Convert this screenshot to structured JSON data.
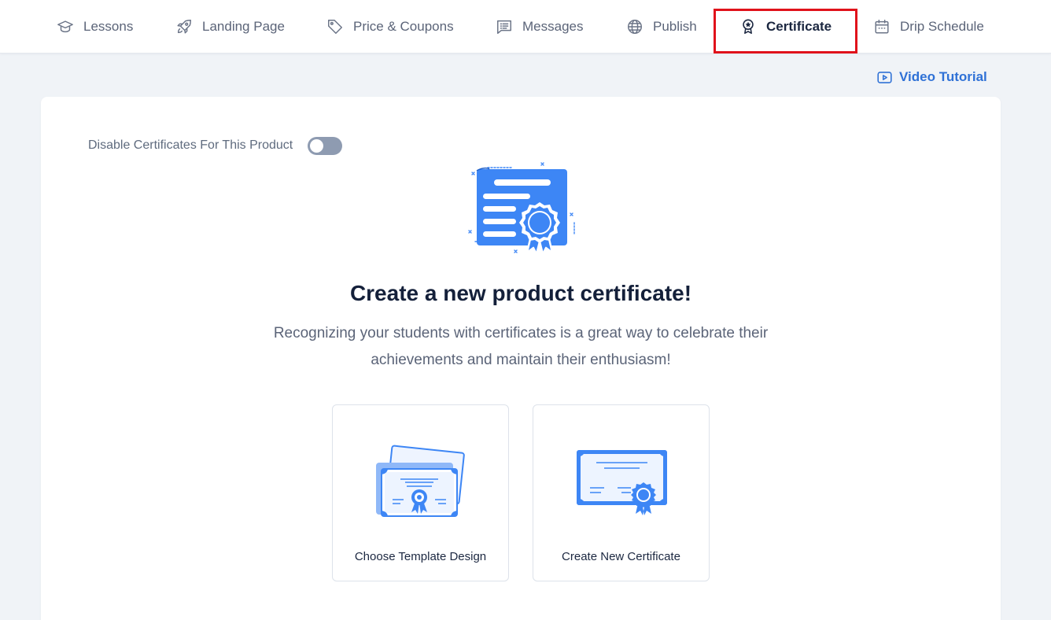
{
  "tabs": [
    {
      "label": "Lessons",
      "icon": "graduation-cap-icon",
      "active": false
    },
    {
      "label": "Landing Page",
      "icon": "rocket-icon",
      "active": false
    },
    {
      "label": "Price & Coupons",
      "icon": "tag-icon",
      "active": false
    },
    {
      "label": "Messages",
      "icon": "message-list-icon",
      "active": false
    },
    {
      "label": "Publish",
      "icon": "globe-icon",
      "active": false
    },
    {
      "label": "Certificate",
      "icon": "award-badge-icon",
      "active": true
    },
    {
      "label": "Drip Schedule",
      "icon": "calendar-icon",
      "active": false
    }
  ],
  "video_tutorial": {
    "label": "Video Tutorial",
    "icon": "play-video-icon"
  },
  "toggle": {
    "label": "Disable Certificates For This Product",
    "enabled": false
  },
  "heading": "Create a new product certificate!",
  "subtext": "Recognizing your students with certificates is a great way to celebrate their achievements and maintain their enthusiasm!",
  "options": [
    {
      "label": "Choose Template Design",
      "icon": "certificate-templates-icon"
    },
    {
      "label": "Create New Certificate",
      "icon": "new-certificate-icon"
    }
  ],
  "colors": {
    "accent": "#2f71d6",
    "illustration_blue": "#3d86f5",
    "highlight_border": "#e0121b",
    "toggle_off": "#8e9bb1",
    "background": "#f0f3f7"
  }
}
